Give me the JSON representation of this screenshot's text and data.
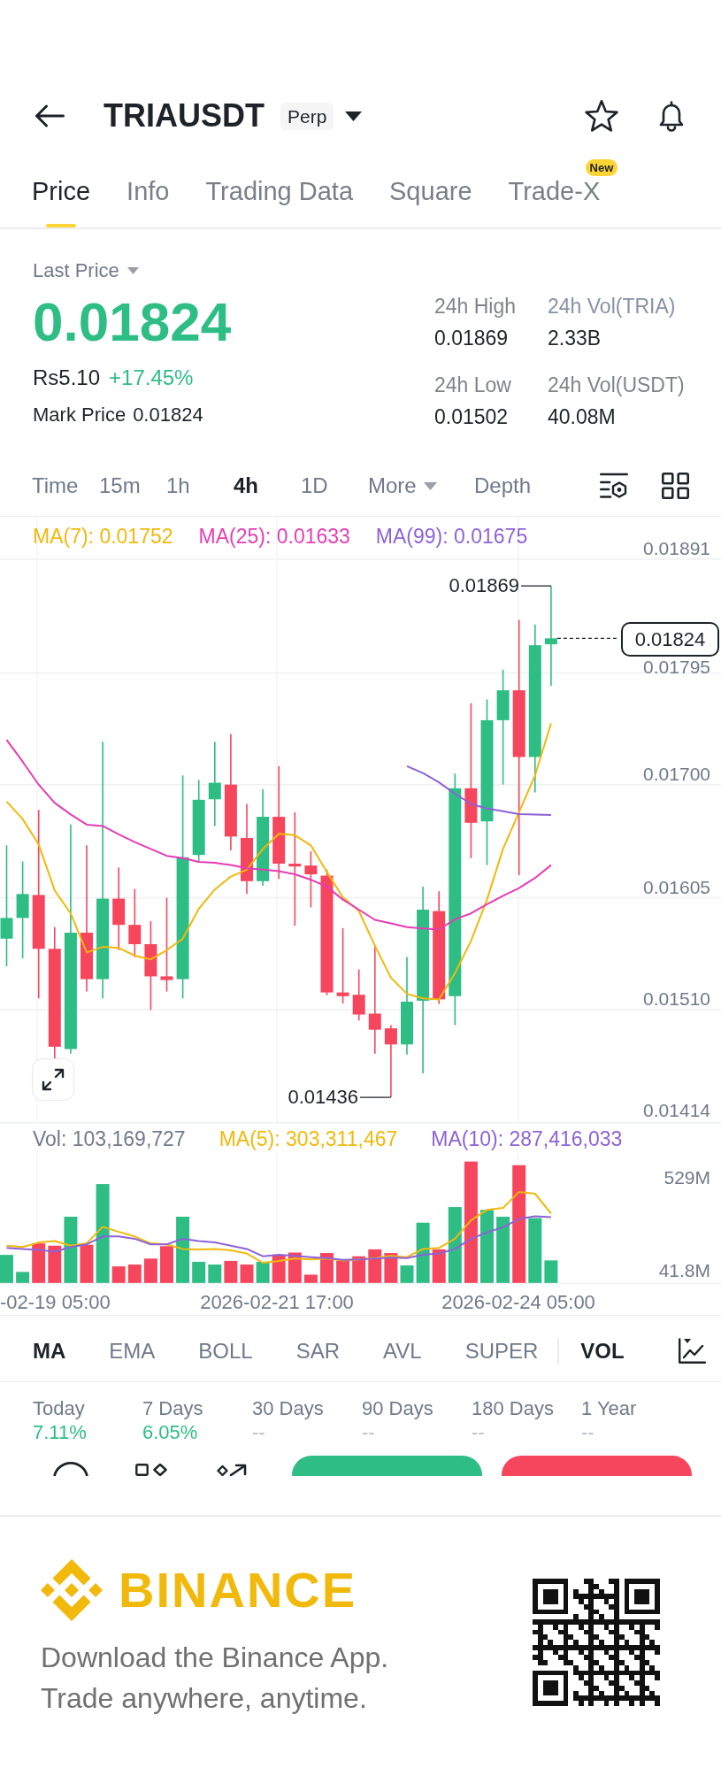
{
  "header": {
    "symbol": "TRIAUSDT",
    "tag": "Perp"
  },
  "tabs": [
    {
      "label": "Price",
      "selected": true
    },
    {
      "label": "Info",
      "selected": false
    },
    {
      "label": "Trading Data",
      "selected": false
    },
    {
      "label": "Square",
      "selected": false
    },
    {
      "label": "Trade-X",
      "selected": false,
      "badge": "New"
    }
  ],
  "price": {
    "selector": "Last Price",
    "last": "0.01824",
    "positive": true,
    "local": "Rs5.10",
    "change": "+17.45%",
    "mark_label": "Mark Price",
    "mark": "0.01824"
  },
  "stats": [
    {
      "label": "24h High",
      "value": "0.01869",
      "kind": "plain"
    },
    {
      "label": "24h Vol(TRIA)",
      "value": "2.33B",
      "kind": "switch"
    },
    {
      "label": "24h Low",
      "value": "0.01502",
      "kind": "plain"
    },
    {
      "label": "24h Vol(USDT)",
      "value": "40.08M",
      "kind": "plain"
    }
  ],
  "intervals": [
    {
      "label": "Time",
      "kind": "option",
      "selected": false
    },
    {
      "label": "15m",
      "kind": "option",
      "selected": false
    },
    {
      "label": "1h",
      "kind": "option",
      "selected": false
    },
    {
      "label": "4h",
      "kind": "option",
      "selected": true
    },
    {
      "label": "1D",
      "kind": "option",
      "selected": false
    },
    {
      "label": "More",
      "kind": "menu",
      "selected": false
    },
    {
      "label": "Depth",
      "kind": "option",
      "selected": false
    }
  ],
  "chart": {
    "legend": [
      {
        "label": "MA(7): 0.01752",
        "color": "#f0b90b"
      },
      {
        "label": "MA(25): 0.01633",
        "color": "#e73cb3"
      },
      {
        "label": "MA(99): 0.01675",
        "color": "#8d62d8"
      }
    ],
    "price_axis": [
      "0.01891",
      "0.01795",
      "0.01700",
      "0.01605",
      "0.01510",
      "0.01414"
    ],
    "high_label": "0.01869",
    "low_label": "0.01436",
    "current_price": "0.01824"
  },
  "volume": {
    "legend": [
      {
        "label": "Vol: 103,169,727",
        "color": "#707a8a"
      },
      {
        "label": "MA(5): 303,311,467",
        "color": "#f0b90b"
      },
      {
        "label": "MA(10): 287,416,033",
        "color": "#8d62d8"
      }
    ],
    "axis": [
      "529M",
      "41.8M"
    ],
    "dates": [
      "-02-19 05:00",
      "2026-02-21 17:00",
      "2026-02-24 05:00"
    ]
  },
  "indicators": {
    "main": [
      {
        "label": "MA",
        "selected": true
      },
      {
        "label": "EMA",
        "selected": false
      },
      {
        "label": "BOLL",
        "selected": false
      },
      {
        "label": "SAR",
        "selected": false
      },
      {
        "label": "AVL",
        "selected": false
      },
      {
        "label": "SUPER",
        "selected": false
      }
    ],
    "sub": [
      {
        "label": "VOL",
        "selected": true
      }
    ]
  },
  "performance": [
    {
      "period": "Today",
      "change": "7.11%",
      "kind": "gain"
    },
    {
      "period": "7 Days",
      "change": "6.05%",
      "kind": "gain"
    },
    {
      "period": "30 Days",
      "change": "--",
      "kind": "empty"
    },
    {
      "period": "90 Days",
      "change": "--",
      "kind": "empty"
    },
    {
      "period": "180 Days",
      "change": "--",
      "kind": "empty"
    },
    {
      "period": "1 Year",
      "change": "--",
      "kind": "empty"
    }
  ],
  "action_bar": {
    "buttons": [
      {
        "color": "#2ebd85"
      },
      {
        "color": "#f6465d"
      }
    ]
  },
  "footer": {
    "brand": "BINANCE",
    "lines": [
      "Download the Binance App.",
      "Trade anywhere, anytime."
    ]
  }
}
